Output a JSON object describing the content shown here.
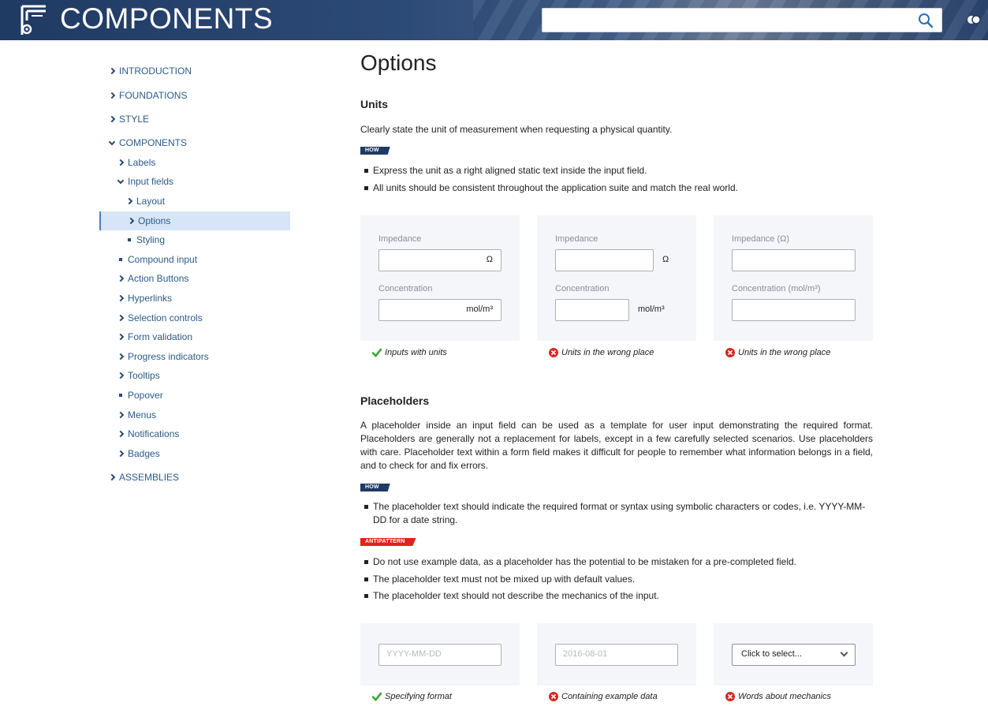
{
  "header": {
    "title": "COMPONENTS",
    "search": {
      "value": "",
      "placeholder": ""
    },
    "icons": {
      "logo": "toolbox-logo-icon",
      "search": "search-icon",
      "toggle": "toggle-icon"
    }
  },
  "sidebar": {
    "items": [
      {
        "label": "INTRODUCTION",
        "marker": "chevron-right"
      },
      {
        "label": "FOUNDATIONS",
        "marker": "chevron-right"
      },
      {
        "label": "STYLE",
        "marker": "chevron-right"
      },
      {
        "label": "COMPONENTS",
        "marker": "chevron-down"
      },
      {
        "label": "Labels",
        "marker": "chevron-right"
      },
      {
        "label": "Input fields",
        "marker": "chevron-down"
      },
      {
        "label": "Layout",
        "marker": "chevron-right"
      },
      {
        "label": "Options",
        "marker": "chevron-right",
        "active": true
      },
      {
        "label": "Styling",
        "marker": "square"
      },
      {
        "label": "Compound input",
        "marker": "square"
      },
      {
        "label": "Action Buttons",
        "marker": "chevron-right"
      },
      {
        "label": "Hyperlinks",
        "marker": "chevron-right"
      },
      {
        "label": "Selection controls",
        "marker": "chevron-right"
      },
      {
        "label": "Form validation",
        "marker": "chevron-right"
      },
      {
        "label": "Progress indicators",
        "marker": "chevron-right"
      },
      {
        "label": "Tooltips",
        "marker": "chevron-right"
      },
      {
        "label": "Popover",
        "marker": "square"
      },
      {
        "label": "Menus",
        "marker": "chevron-right"
      },
      {
        "label": "Notifications",
        "marker": "chevron-right"
      },
      {
        "label": "Badges",
        "marker": "chevron-right"
      },
      {
        "label": "ASSEMBLIES",
        "marker": "chevron-right"
      }
    ]
  },
  "main": {
    "title": "Options",
    "units": {
      "heading": "Units",
      "intro": "Clearly state the unit of measurement when requesting a physical quantity.",
      "how_tag": "HOW",
      "bullets": [
        "Express the unit as a right aligned static text inside the input field.",
        "All units should be consistent throughout the application suite and match the real world."
      ],
      "examples": [
        {
          "label1": "Impedance",
          "unit1": "Ω",
          "label2": "Concentration",
          "unit2": "mol/m³",
          "caption": "Inputs with units",
          "status": "correct"
        },
        {
          "label1": "Impedance",
          "unit1": "Ω",
          "label2": "Concentration",
          "unit2": "mol/m³",
          "caption": "Units in the wrong place",
          "status": "wrong"
        },
        {
          "label1": "Impedance (Ω)",
          "label2": "Concentration (mol/m³)",
          "caption": "Units in the wrong place",
          "status": "wrong"
        }
      ]
    },
    "placeholders": {
      "heading": "Placeholders",
      "intro": "A placeholder inside an input field can be used as a template for user input demonstrating the required format. Placeholders are generally not a replacement for labels, except in a few carefully selected scenarios. Use placeholders with care. Placeholder text within a form field makes it difficult for people to remember what information belongs in a field, and to check for and fix errors.",
      "how_tag": "HOW",
      "how_bullets": [
        "The placeholder text should indicate the required format or syntax using symbolic characters or codes, i.e. YYYY-MM-DD for a date string."
      ],
      "anti_tag": "ANTIPATTERN",
      "anti_bullets": [
        "Do not use example data, as a placeholder has the potential to be mistaken for a pre-completed field.",
        "The placeholder text must not be mixed up with default values.",
        "The placeholder text should not describe the mechanics of the input."
      ],
      "examples": [
        {
          "placeholder": "YYYY-MM-DD",
          "caption": "Specifying format",
          "status": "correct"
        },
        {
          "placeholder": "2016-08-01",
          "caption": "Containing example data",
          "status": "wrong"
        },
        {
          "select_text": "Click to select...",
          "caption": "Words about mechanics",
          "status": "wrong"
        }
      ]
    }
  },
  "colors": {
    "header_bg": "#1f3a63",
    "nav_link": "#2b5b8a",
    "active_nav_bg": "#d6e6f8",
    "how_tag": "#1f3a63",
    "antipattern_tag": "#e2231a",
    "correct": "#3fa33a",
    "wrong": "#d7261e",
    "panel_bg": "#f4f6f9"
  }
}
